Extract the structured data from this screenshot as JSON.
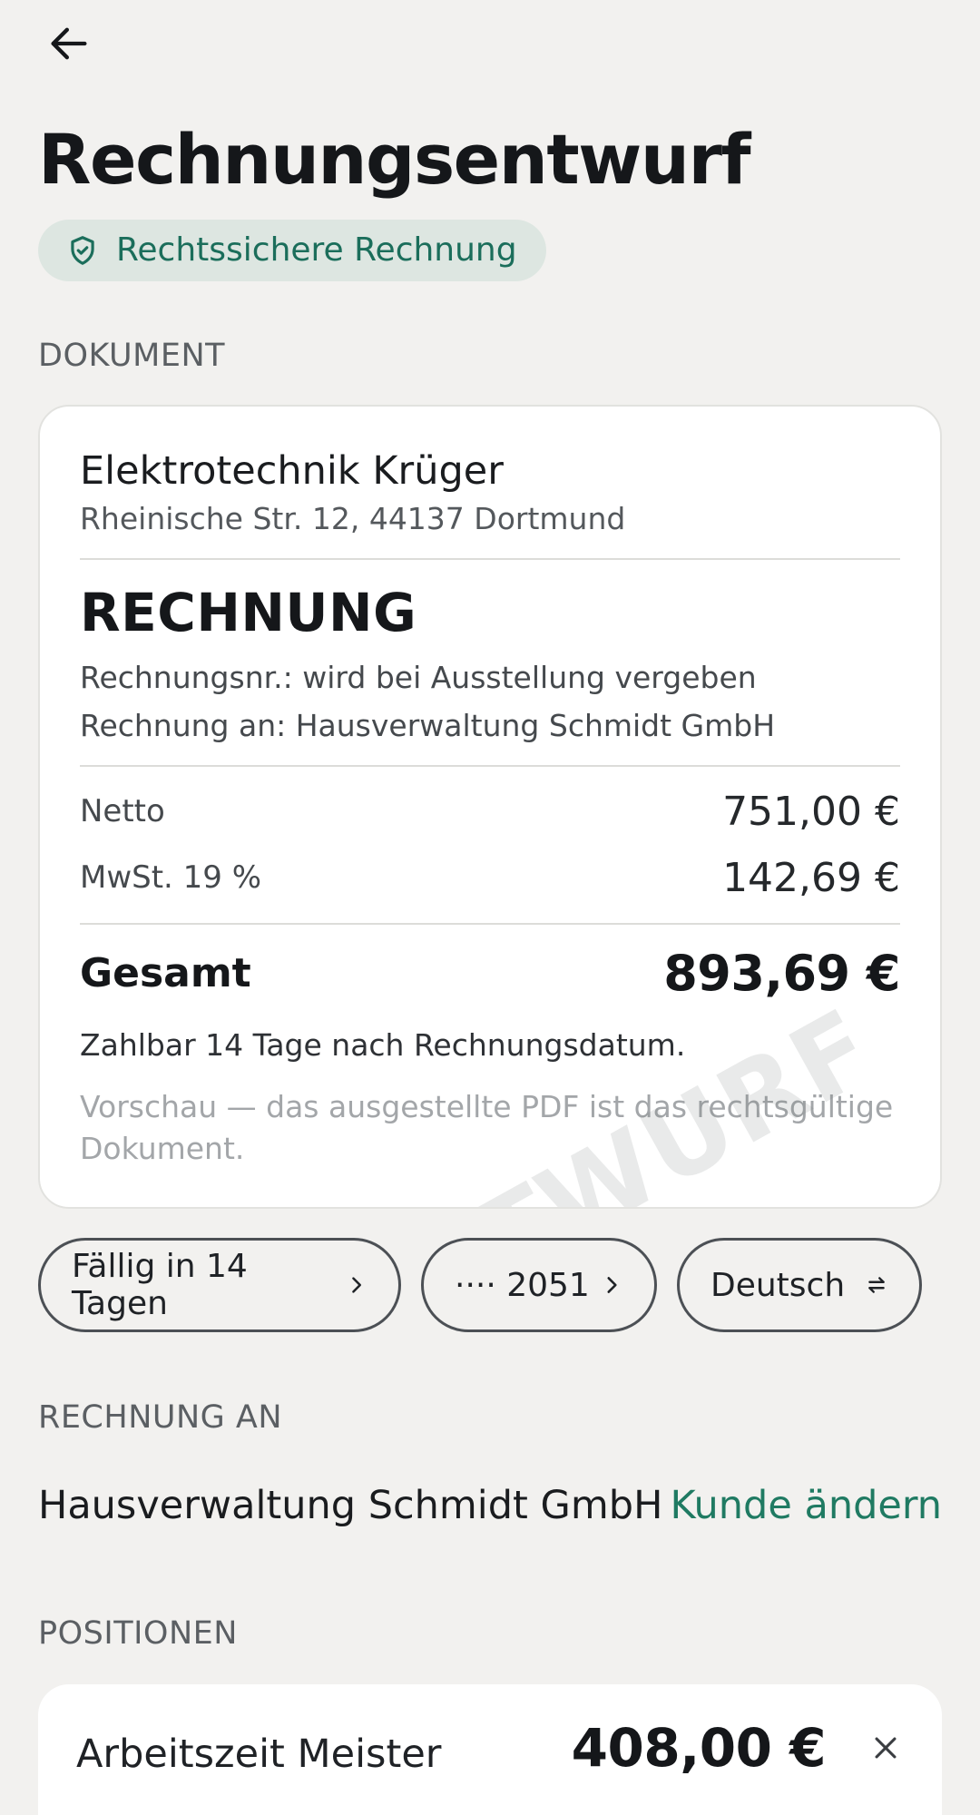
{
  "header": {
    "title": "Rechnungsentwurf"
  },
  "badge": {
    "label": "Rechtssichere Rechnung"
  },
  "sections": {
    "document": "DOKUMENT",
    "recipient": "RECHNUNG AN",
    "positions": "POSITIONEN"
  },
  "document": {
    "company_name": "Elektrotechnik Krüger",
    "company_address": "Rheinische Str. 12, 44137 Dortmund",
    "doc_type": "RECHNUNG",
    "invoice_number_line": "Rechnungsnr.: wird bei Ausstellung vergeben",
    "bill_to_line": "Rechnung an: Hausverwaltung Schmidt GmbH",
    "netto_label": "Netto",
    "netto_value": "751,00 €",
    "vat_label": "MwSt. 19 %",
    "vat_value": "142,69 €",
    "total_label": "Gesamt",
    "total_value": "893,69 €",
    "payment_terms": "Zahlbar 14 Tage nach Rechnungsdatum.",
    "preview_note": "Vorschau — das ausgestellte PDF ist das rechtsgültige Dokument.",
    "watermark": "ENTWURF"
  },
  "chips": {
    "due": "Fällig in 14 Tagen",
    "account": "···· 2051",
    "language": "Deutsch"
  },
  "recipient": {
    "name": "Hausverwaltung Schmidt GmbH",
    "change_label": "Kunde ändern"
  },
  "positions": [
    {
      "name": "Arbeitszeit Meister",
      "amount": "408,00 €"
    }
  ],
  "colors": {
    "background": "#f2f1ef",
    "accent": "#1f7a62",
    "badge_bg": "#dde6e1"
  },
  "icons": [
    "arrow-left-icon",
    "shield-check-icon",
    "chevron-right-icon",
    "swap-icon",
    "close-icon"
  ]
}
